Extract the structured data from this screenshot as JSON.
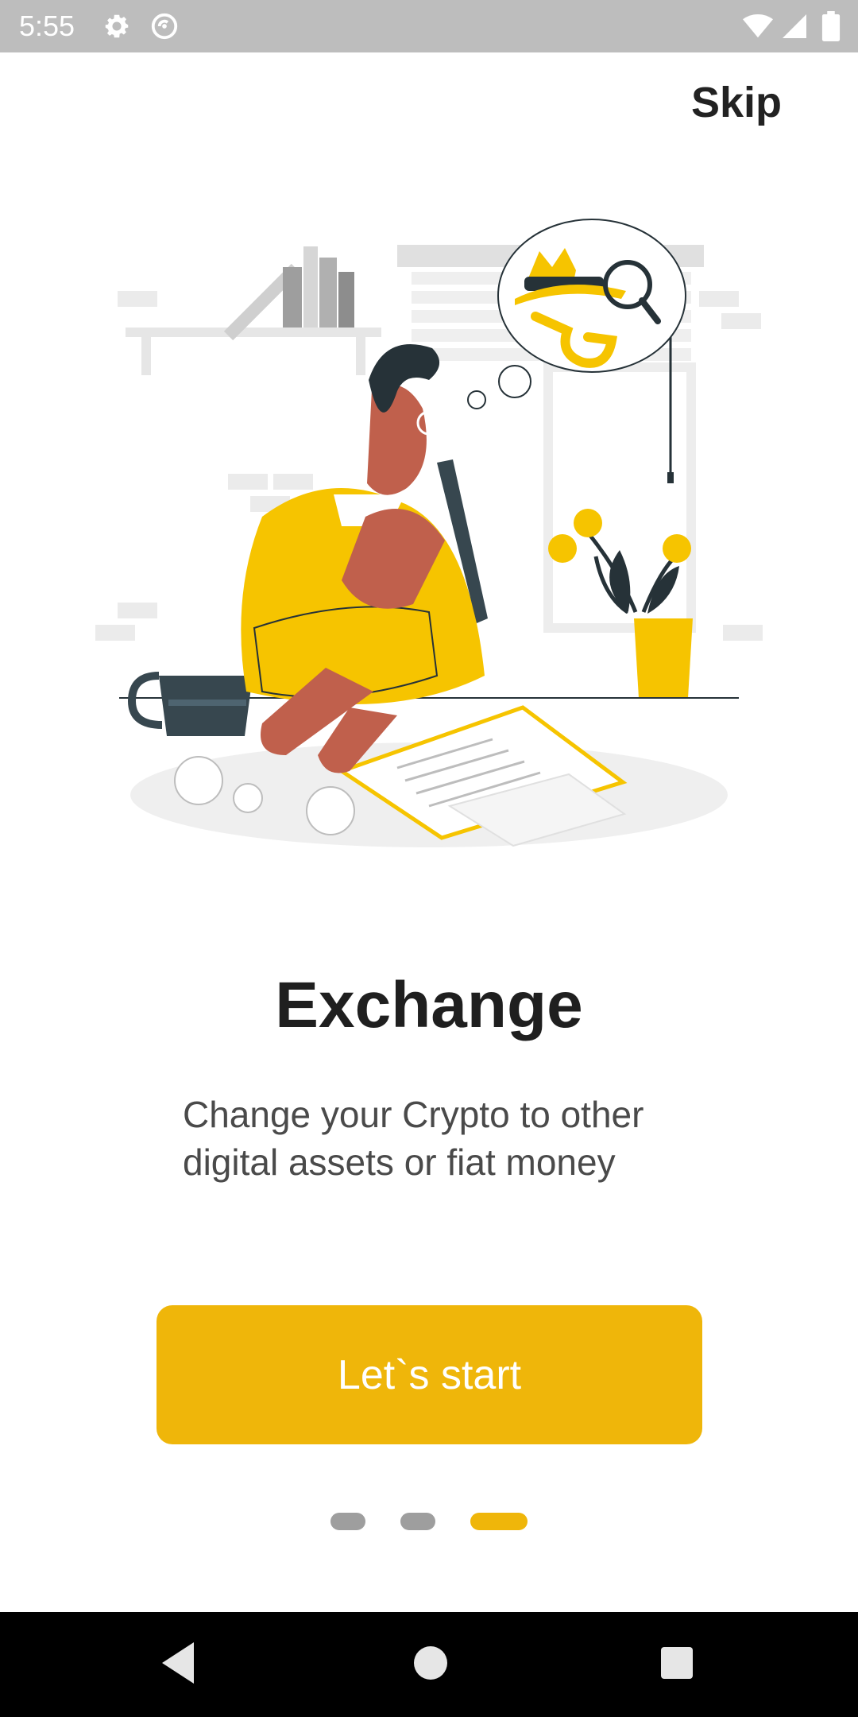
{
  "status_bar": {
    "time": "5:55",
    "icons": [
      "gear-icon",
      "sync-icon",
      "wifi-icon",
      "signal-icon",
      "battery-icon"
    ]
  },
  "header": {
    "skip_label": "Skip"
  },
  "onboarding": {
    "title": "Exchange",
    "subtitle": "Change your Crypto to other digital assets or fiat money",
    "cta_label": "Let`s start",
    "pages_total": 3,
    "current_page": 3
  },
  "nav_bar": {
    "icons": [
      "back-icon",
      "home-icon",
      "recents-icon"
    ]
  },
  "colors": {
    "accent": "#efb60a",
    "status_bar": "#bdbdbd",
    "dot_inactive": "#9e9e9e",
    "title_text": "#1f1f1f",
    "body_text": "#4a4a4a"
  }
}
